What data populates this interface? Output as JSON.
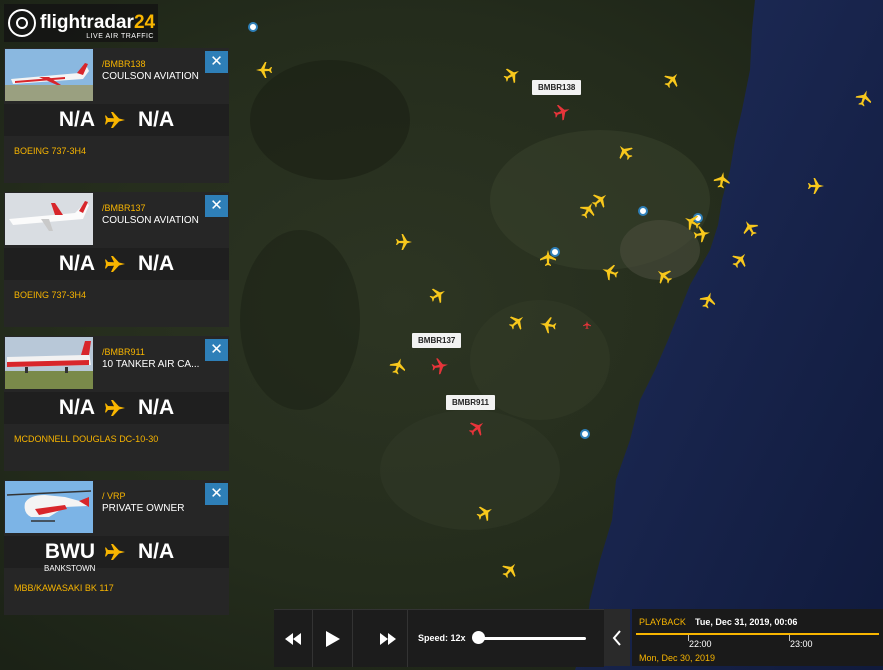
{
  "app": {
    "logo_word": "flightradar",
    "logo_num": "24",
    "logo_sub": "LIVE AIR TRAFFIC"
  },
  "panels": [
    {
      "callsign": "/BMBR138",
      "airline": "COULSON AVIATION",
      "origin": "N/A",
      "origin_sub": "",
      "destination": "N/A",
      "aircraft": "BOEING 737-3H4",
      "close": "✕",
      "photo": "red-white-jet-photo"
    },
    {
      "callsign": "/BMBR137",
      "airline": "COULSON AVIATION",
      "origin": "N/A",
      "origin_sub": "",
      "destination": "N/A",
      "aircraft": "BOEING 737-3H4",
      "close": "✕",
      "photo": "white-red-jet-photo"
    },
    {
      "callsign": "/BMBR911",
      "airline": "10 TANKER AIR CA...",
      "origin": "N/A",
      "origin_sub": "",
      "destination": "N/A",
      "aircraft": "MCDONNELL DOUGLAS DC-10-30",
      "close": "✕",
      "photo": "dc10-tanker-photo"
    },
    {
      "callsign": "/ VRP",
      "airline": "PRIVATE OWNER",
      "origin": "BWU",
      "origin_sub": "BANKSTOWN",
      "destination": "N/A",
      "aircraft": "MBB/KAWASAKI BK 117",
      "close": "✕",
      "photo": "helicopter-photo"
    }
  ],
  "map_labels": [
    {
      "text": "BMBR138"
    },
    {
      "text": "BMBR137"
    },
    {
      "text": "BMBR911"
    }
  ],
  "controls": {
    "rewind_icon": "rewind-icon",
    "play_icon": "play-icon",
    "forward_icon": "fast-forward-icon",
    "speed_label": "Speed: 12x",
    "speed_fraction": 0.0
  },
  "playback": {
    "title": "PLAYBACK",
    "date": "Tue, Dec 31, 2019, 00:06",
    "tick1": "22:00",
    "tick2": "23:00",
    "day": "Mon, Dec 30, 2019",
    "collapse_icon": "chevron-left-icon"
  },
  "colors": {
    "accent": "#f8b500",
    "close_button": "#2e7fb8",
    "highlight_plane": "#e8343a"
  }
}
